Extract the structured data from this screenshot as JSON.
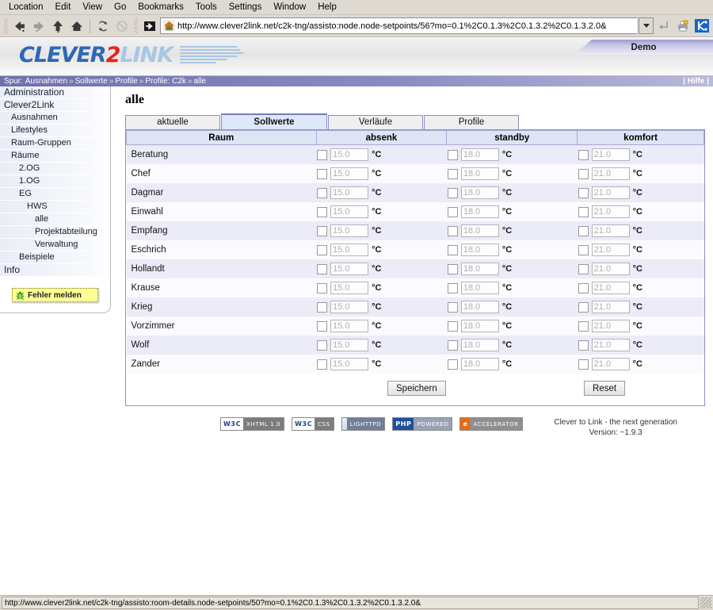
{
  "browser": {
    "menus": [
      "Location",
      "Edit",
      "View",
      "Go",
      "Bookmarks",
      "Tools",
      "Settings",
      "Window",
      "Help"
    ],
    "url": "http://www.clever2link.net/c2k-tng/assisto:node.node-setpoints/56?mo=0.1%2C0.1.3%2C0.1.3.2%2C0.1.3.2.0&",
    "status_url": "http://www.clever2link.net/c2k-tng/assisto:room-details.node-setpoints/50?mo=0.1%2C0.1.3%2C0.1.3.2%2C0.1.3.2.0&"
  },
  "header": {
    "logo_part1": "CLEVER",
    "logo_part2": "2",
    "logo_part3": "LINK",
    "demo_label": "Demo",
    "help_label": "| Hilfe |",
    "brand_blue": "#2f68b5",
    "brand_red": "#e2241b",
    "brand_lightblue": "#a8c6e6"
  },
  "breadcrumb": {
    "prefix": "Spur:",
    "items": [
      "Ausnahmen",
      "Sollwerte",
      "Profile",
      "Profile: C2k",
      "alle"
    ],
    "separator": "»"
  },
  "sidebar": {
    "items": [
      {
        "label": "Administration",
        "level": 0
      },
      {
        "label": "Clever2Link",
        "level": 0
      },
      {
        "label": "Ausnahmen",
        "level": 1
      },
      {
        "label": "Lifestyles",
        "level": 1
      },
      {
        "label": "Raum-Gruppen",
        "level": 1
      },
      {
        "label": "Räume",
        "level": 1
      },
      {
        "label": "2.OG",
        "level": 2
      },
      {
        "label": "1.OG",
        "level": 2
      },
      {
        "label": "EG",
        "level": 2
      },
      {
        "label": "HWS",
        "level": 3
      },
      {
        "label": "alle",
        "level": 4
      },
      {
        "label": "Projektabteilung",
        "level": 4
      },
      {
        "label": "Verwaltung",
        "level": 4
      },
      {
        "label": "Beispiele",
        "level": 2
      },
      {
        "label": "Info",
        "level": 0
      }
    ],
    "report_button": "Fehler melden"
  },
  "main": {
    "page_title": "alle",
    "tabs": [
      {
        "label": "aktuelle",
        "active": false
      },
      {
        "label": "Sollwerte",
        "active": true
      },
      {
        "label": "Verläufe",
        "active": false
      },
      {
        "label": "Profile",
        "active": false
      }
    ],
    "columns": [
      "Raum",
      "absenk",
      "standby",
      "komfort"
    ],
    "unit": "°C",
    "rows": [
      {
        "room": "Beratung",
        "absenk": "15.0",
        "standby": "18.0",
        "komfort": "21.0"
      },
      {
        "room": "Chef",
        "absenk": "15.0",
        "standby": "18.0",
        "komfort": "21.0"
      },
      {
        "room": "Dagmar",
        "absenk": "15.0",
        "standby": "18.0",
        "komfort": "21.0"
      },
      {
        "room": "Einwahl",
        "absenk": "15.0",
        "standby": "18.0",
        "komfort": "21.0"
      },
      {
        "room": "Empfang",
        "absenk": "15.0",
        "standby": "18.0",
        "komfort": "21.0"
      },
      {
        "room": "Eschrich",
        "absenk": "15.0",
        "standby": "18.0",
        "komfort": "21.0"
      },
      {
        "room": "Hollandt",
        "absenk": "15.0",
        "standby": "18.0",
        "komfort": "21.0"
      },
      {
        "room": "Krause",
        "absenk": "15.0",
        "standby": "18.0",
        "komfort": "21.0"
      },
      {
        "room": "Krieg",
        "absenk": "15.0",
        "standby": "18.0",
        "komfort": "21.0"
      },
      {
        "room": "Vorzimmer",
        "absenk": "15.0",
        "standby": "18.0",
        "komfort": "21.0"
      },
      {
        "room": "Wolf",
        "absenk": "15.0",
        "standby": "18.0",
        "komfort": "21.0"
      },
      {
        "room": "Zander",
        "absenk": "15.0",
        "standby": "18.0",
        "komfort": "21.0"
      }
    ],
    "save_label": "Speichern",
    "reset_label": "Reset"
  },
  "footer": {
    "badges": [
      {
        "left": "W3C",
        "right": "XHTML 1.0",
        "kind": "w3c"
      },
      {
        "left": "W3C",
        "right": "CSS",
        "kind": "w3c"
      },
      {
        "left": "",
        "right": "LIGHTTPD",
        "kind": "lig"
      },
      {
        "left": "PHP",
        "right": "POWERED",
        "kind": "php"
      },
      {
        "left": "e",
        "right": "ACCELERATOR",
        "kind": "acc"
      }
    ],
    "tagline": "Clever to Link - the next generation",
    "version": "Version: ~1.9.3"
  }
}
